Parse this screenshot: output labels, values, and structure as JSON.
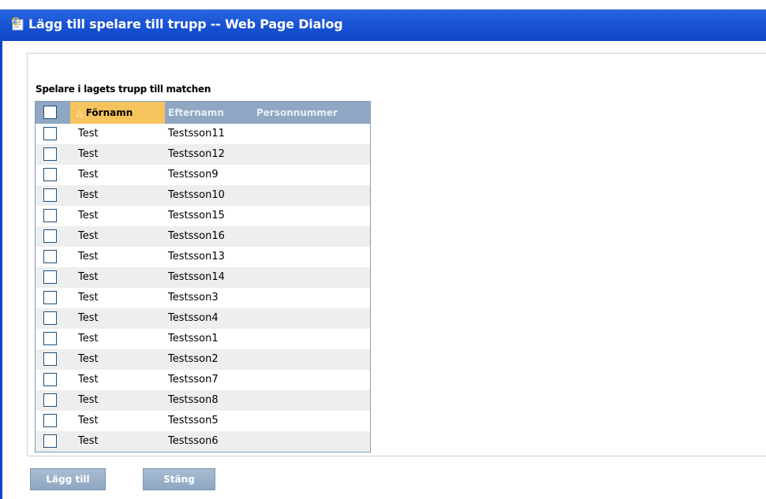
{
  "window": {
    "title": "Lägg till spelare till trupp -- Web Page Dialog"
  },
  "section": {
    "label": "Spelare i lagets trupp till matchen"
  },
  "grid": {
    "columns": [
      {
        "label": "Förnamn",
        "sort": "ascending"
      },
      {
        "label": "Efternamn"
      },
      {
        "label": "Personnummer"
      }
    ],
    "sort_icon": "sort-ascending-icon",
    "rows": [
      {
        "first": "Test",
        "last": "Testsson11",
        "pnr": ""
      },
      {
        "first": "Test",
        "last": "Testsson12",
        "pnr": ""
      },
      {
        "first": "Test",
        "last": "Testsson9",
        "pnr": ""
      },
      {
        "first": "Test",
        "last": "Testsson10",
        "pnr": ""
      },
      {
        "first": "Test",
        "last": "Testsson15",
        "pnr": ""
      },
      {
        "first": "Test",
        "last": "Testsson16",
        "pnr": ""
      },
      {
        "first": "Test",
        "last": "Testsson13",
        "pnr": ""
      },
      {
        "first": "Test",
        "last": "Testsson14",
        "pnr": ""
      },
      {
        "first": "Test",
        "last": "Testsson3",
        "pnr": ""
      },
      {
        "first": "Test",
        "last": "Testsson4",
        "pnr": ""
      },
      {
        "first": "Test",
        "last": "Testsson1",
        "pnr": ""
      },
      {
        "first": "Test",
        "last": "Testsson2",
        "pnr": ""
      },
      {
        "first": "Test",
        "last": "Testsson7",
        "pnr": ""
      },
      {
        "first": "Test",
        "last": "Testsson8",
        "pnr": ""
      },
      {
        "first": "Test",
        "last": "Testsson5",
        "pnr": ""
      },
      {
        "first": "Test",
        "last": "Testsson6",
        "pnr": ""
      }
    ]
  },
  "buttons": {
    "add_label": "Lägg till",
    "close_label": "Stäng"
  },
  "colors": {
    "titlebar": "#0c45c6",
    "grid_header": "#8fa7c2",
    "sorted_header": "#f7c35c",
    "button": "#8ea6c1"
  }
}
